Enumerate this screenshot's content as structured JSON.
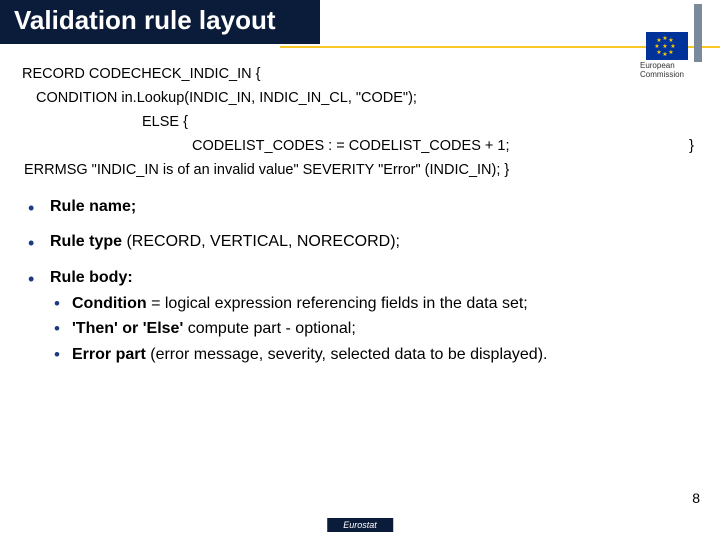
{
  "title": "Validation rule  layout",
  "logo": {
    "line1": "European",
    "line2": "Commission"
  },
  "code": {
    "l1": "RECORD CODECHECK_INDIC_IN {",
    "l2": "CONDITION in.Lookup(INDIC_IN, INDIC_IN_CL, \"CODE\");",
    "l3": "ELSE {",
    "l4": "CODELIST_CODES : = CODELIST_CODES + 1;",
    "l4r": "}",
    "l5": "ERRMSG \"INDIC_IN is of an invalid value\" SEVERITY \"Error\" (INDIC_IN); }"
  },
  "bullets": {
    "b1": {
      "bold": "Rule name;"
    },
    "b2": {
      "bold": "Rule type",
      "rest": " (RECORD, VERTICAL, NORECORD);"
    },
    "b3": {
      "bold": "Rule body:"
    },
    "sub": {
      "s1": {
        "bold": "Condition",
        "rest": " = logical expression referencing fields in the data set;"
      },
      "s2": {
        "bold": "'Then' or 'Else'",
        "rest": " compute part - optional;"
      },
      "s3": {
        "bold": "Error part",
        "rest": " (error message, severity, selected data to be displayed)."
      }
    }
  },
  "page_number": "8",
  "footer": "Eurostat"
}
